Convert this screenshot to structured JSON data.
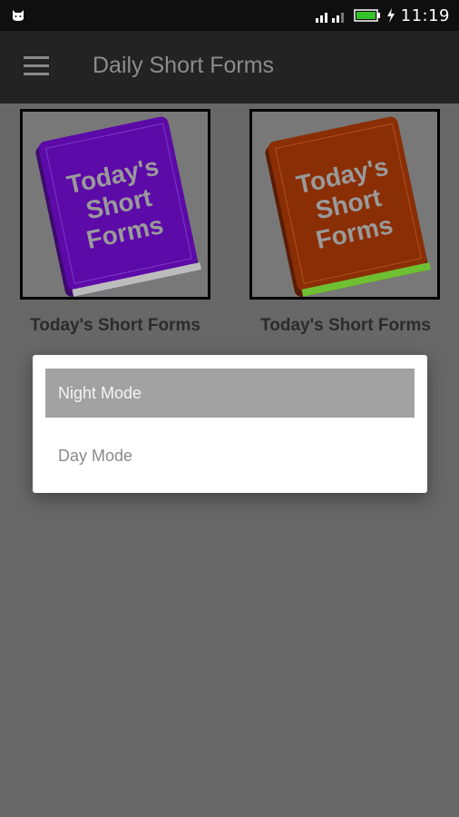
{
  "status_bar": {
    "time": "11:19",
    "icons": [
      "cat-notification-icon",
      "signal-icon",
      "battery-icon",
      "charging-icon"
    ]
  },
  "app_bar": {
    "title": "Daily Short Forms",
    "menu_icon": "hamburger-menu-icon"
  },
  "cards": [
    {
      "label": "Today's Short Forms",
      "book_text": [
        "Today's",
        "Short",
        "Forms"
      ],
      "color": "#5c0aa8"
    },
    {
      "label": "Today's Short Forms",
      "book_text": [
        "Today's",
        "Short",
        "Forms"
      ],
      "color": "#8a2e06"
    }
  ],
  "dialog": {
    "options": [
      {
        "label": "Night Mode",
        "selected": true
      },
      {
        "label": "Day Mode",
        "selected": false
      }
    ]
  }
}
